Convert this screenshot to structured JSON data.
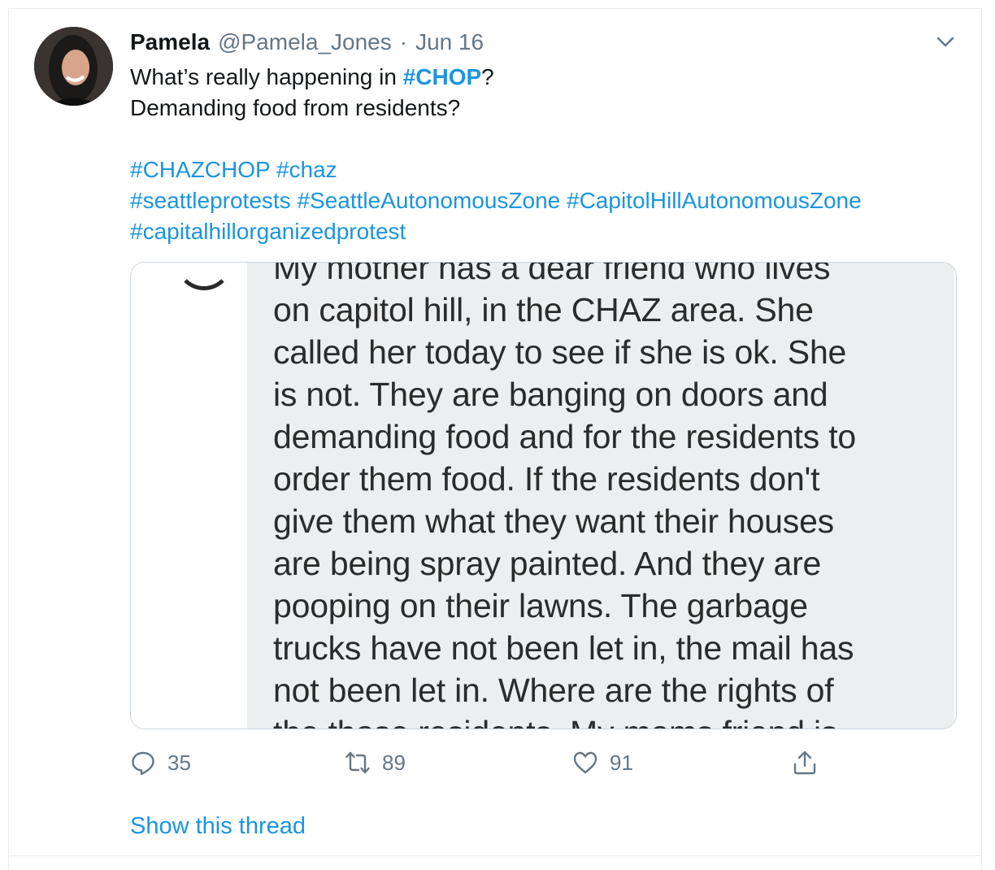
{
  "tweet": {
    "author_name": "Pamela",
    "handle": "@Pamela_Jones",
    "separator": "·",
    "date": "Jun 16",
    "text_prefix": "What’s really happening in ",
    "hashtag_main": "#CHOP",
    "text_suffix": "?",
    "line2": "Demanding food from residents?",
    "hashtags_row1": [
      "#CHAZCHOP",
      "#chaz"
    ],
    "hashtags_row2": [
      "#seattleprotests",
      "#SeattleAutonomousZone",
      "#CapitolHillAutonomousZone"
    ],
    "hashtags_row3": [
      "#capitalhillorganizedprotest"
    ]
  },
  "media": {
    "lines": [
      "My mother has a dear friend who lives",
      "on capitol hill, in the CHAZ area. She",
      "called her today to see if she is ok. She",
      "is not. They are banging on doors and",
      "demanding food and for the residents to",
      "order them food. If the residents don't",
      "give them what they want their houses",
      "are being spray painted. And they are",
      "pooping on their lawns. The garbage",
      "trucks have not been let in, the mail has",
      "not been let in. Where are the rights of",
      "the those residents. My moms friend is"
    ]
  },
  "actions": {
    "reply_count": "35",
    "retweet_count": "89",
    "like_count": "91"
  },
  "thread_link": "Show this thread",
  "colors": {
    "link": "#1b95e0",
    "muted": "#657786",
    "text": "#14171a"
  },
  "icons": [
    "avatar",
    "chevron-down-icon",
    "reply-icon",
    "retweet-icon",
    "like-icon",
    "share-icon"
  ]
}
